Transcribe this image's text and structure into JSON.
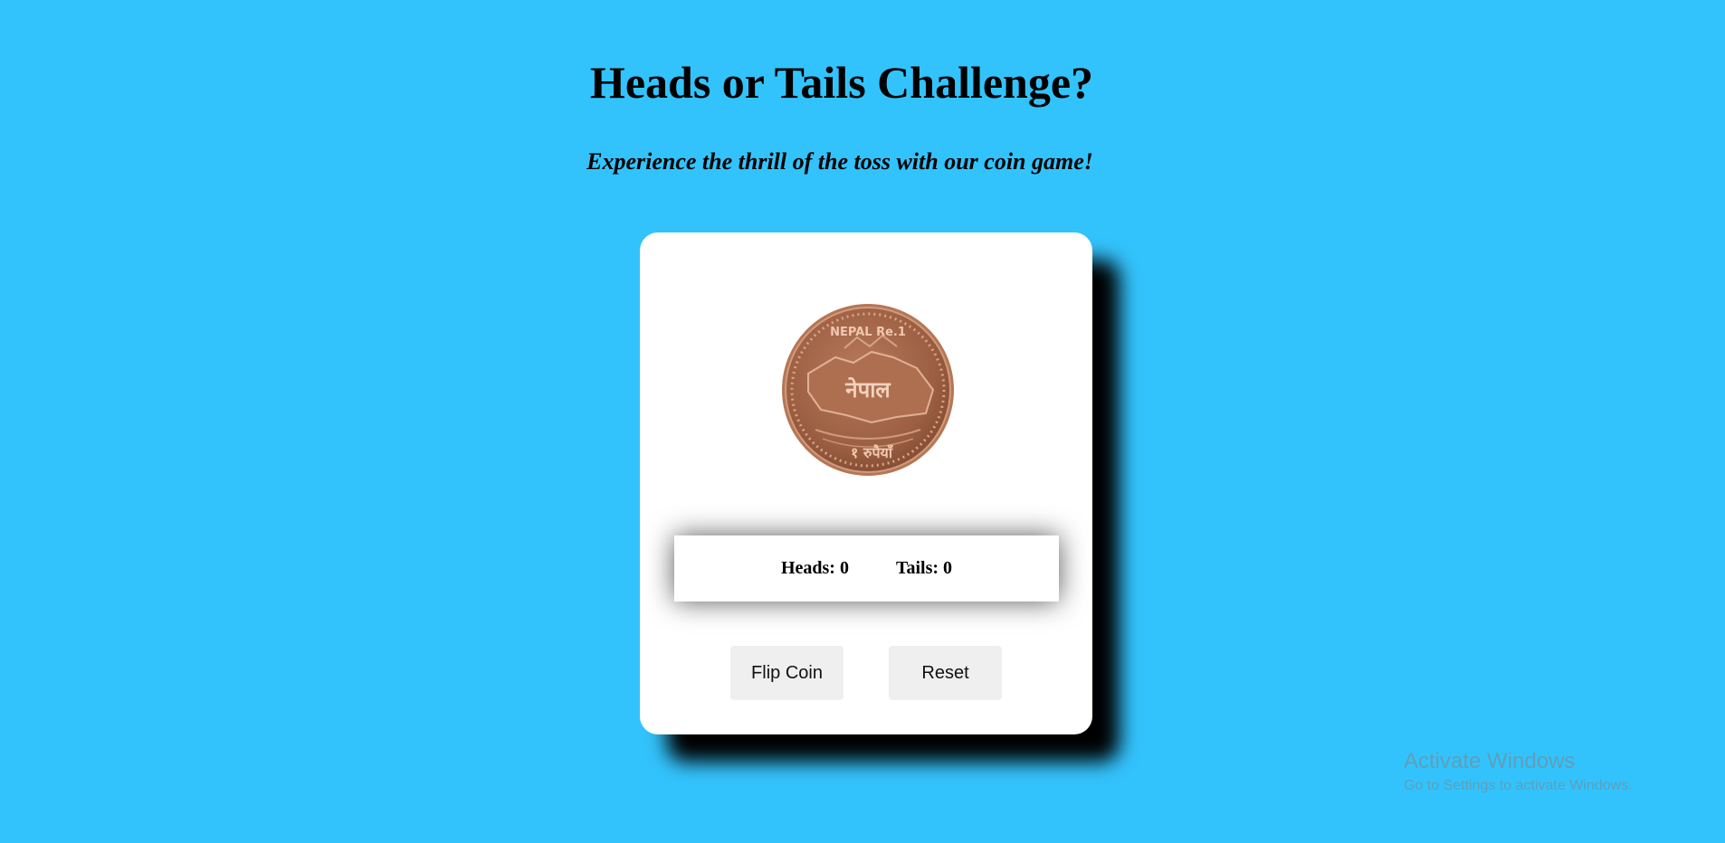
{
  "header": {
    "title": "Heads or Tails Challenge?",
    "subtitle": "Experience the thrill of the toss with our coin game!"
  },
  "coin": {
    "icon": "coin-icon",
    "country_text": "NEPAL Re.1",
    "face_text": "नेपाल",
    "value_text": "१ रुपैयाँ",
    "colors": {
      "coin": "#a5674a",
      "rim": "#c88d6e"
    }
  },
  "score": {
    "heads_label": "Heads: 0",
    "tails_label": "Tails: 0",
    "heads": 0,
    "tails": 0
  },
  "controls": {
    "flip_label": "Flip Coin",
    "reset_label": "Reset"
  },
  "watermark": {
    "title": "Activate Windows",
    "subtitle": "Go to Settings to activate Windows."
  },
  "colors": {
    "background": "#33c3fc",
    "card": "#ffffff",
    "button": "#efefef"
  }
}
